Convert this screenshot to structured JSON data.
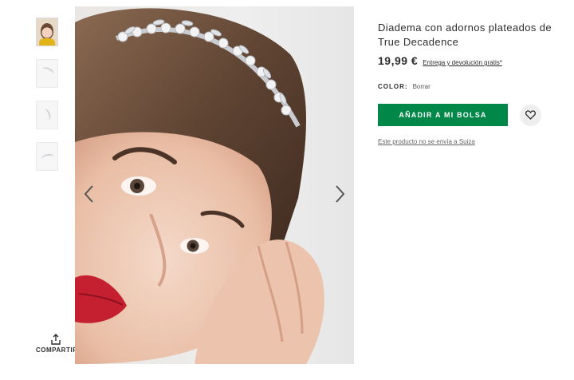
{
  "product": {
    "title": "Diadema con adornos plateados de True Decadence",
    "price": "19,99 €",
    "shipping_link": "Entrega y devolución gratis*",
    "color_label": "COLOR:",
    "color_value": "Borrar",
    "add_to_bag": "AÑADIR A MI BOLSA",
    "shipping_notice": "Este producto no se envía a Suiza"
  },
  "gallery": {
    "thumbnails": [
      "thumbnail-1",
      "thumbnail-2",
      "thumbnail-3",
      "thumbnail-4"
    ],
    "share_label": "COMPARTIR"
  },
  "colors": {
    "accent": "#018849",
    "text": "#2d2d2d",
    "wishlist_bg": "#eeeeee"
  },
  "icons": {
    "share": "share-icon",
    "wishlist": "heart-icon",
    "prev": "chevron-left-icon",
    "next": "chevron-right-icon"
  }
}
